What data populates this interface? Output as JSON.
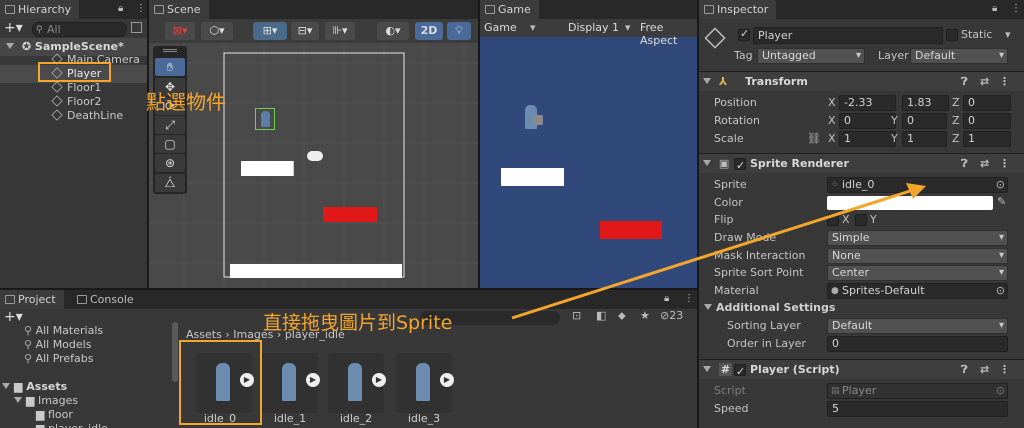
{
  "hierarchy": {
    "tab": "Hierarchy",
    "search_placeholder": "All",
    "scene": "SampleScene*",
    "items": [
      "Main Camera",
      "Player",
      "Floor1",
      "Floor2",
      "DeathLine"
    ]
  },
  "scene_view": {
    "tab": "Scene",
    "mode_2d": "2D"
  },
  "game_view": {
    "tab": "Game",
    "dropdown": "Game",
    "display": "Display 1",
    "aspect": "Free Aspect"
  },
  "inspector": {
    "tab": "Inspector",
    "object_name": "Player",
    "static_label": "Static",
    "tag_label": "Tag",
    "tag_value": "Untagged",
    "layer_label": "Layer",
    "layer_value": "Default",
    "transform": {
      "title": "Transform",
      "position_label": "Position",
      "rotation_label": "Rotation",
      "scale_label": "Scale",
      "axis_x": "X",
      "axis_y": "Y",
      "axis_z": "Z",
      "position": [
        "-2.33",
        "1.83",
        "0"
      ],
      "rotation": [
        "0",
        "0",
        "0"
      ],
      "scale": [
        "1",
        "1",
        "1"
      ]
    },
    "sprite_renderer": {
      "title": "Sprite Renderer",
      "sprite_label": "Sprite",
      "sprite_value": "idle_0",
      "color_label": "Color",
      "flip_label": "Flip",
      "flip_x": "X",
      "flip_y": "Y",
      "draw_mode_label": "Draw Mode",
      "draw_mode_value": "Simple",
      "mask_label": "Mask Interaction",
      "mask_value": "None",
      "sort_point_label": "Sprite Sort Point",
      "sort_point_value": "Center",
      "material_label": "Material",
      "material_value": "Sprites-Default",
      "additional_label": "Additional Settings",
      "sorting_layer_label": "Sorting Layer",
      "sorting_layer_value": "Default",
      "order_label": "Order in Layer",
      "order_value": "0"
    },
    "player_script": {
      "title": "Player (Script)",
      "script_label": "Script",
      "script_value": "Player",
      "speed_label": "Speed",
      "speed_value": "5"
    }
  },
  "project": {
    "tab_project": "Project",
    "tab_console": "Console",
    "favorites": [
      "All Materials",
      "All Models",
      "All Prefabs"
    ],
    "assets_root": "Assets",
    "folders": [
      "Images",
      "floor",
      "player_idle"
    ],
    "breadcrumb": [
      "Assets",
      "Images",
      "player_idle"
    ],
    "hidden_count": "23",
    "assets": [
      "idle_0",
      "idle_1",
      "idle_2",
      "idle_3"
    ]
  },
  "annotations": {
    "click_object": "點選物件",
    "drag_hint": "直接拖曳圖片到Sprite"
  },
  "colors": {
    "accent_orange": "#f3a52c",
    "game_bg": "#31487a",
    "red_platform": "#e01818",
    "selection": "#2c5d87"
  }
}
